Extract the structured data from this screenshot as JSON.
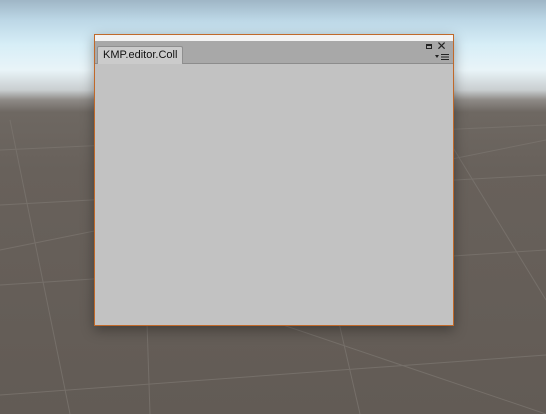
{
  "window": {
    "tab_label": "KMP.editor.Coll"
  },
  "icons": {
    "maximize": "maximize-icon",
    "close": "close-icon",
    "menu": "menu-icon"
  },
  "colors": {
    "window_border": "#c0692a",
    "content_bg": "#c2c2c2",
    "tabstrip_bg": "#a8a8a8",
    "ground": "#625b55",
    "sky": "#d7eef7"
  }
}
